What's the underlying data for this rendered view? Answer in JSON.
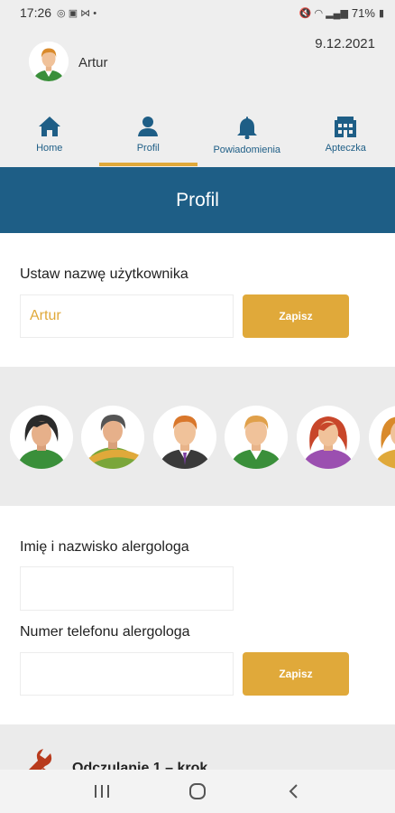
{
  "statusbar": {
    "time": "17:26",
    "battery": "71%"
  },
  "header": {
    "username": "Artur",
    "date": "9.12.2021"
  },
  "tabs": [
    {
      "label": "Home",
      "icon": "home-icon"
    },
    {
      "label": "Profil",
      "icon": "user-icon"
    },
    {
      "label": "Powiadomienia",
      "icon": "bell-icon"
    },
    {
      "label": "Apteczka",
      "icon": "pharmacy-icon"
    }
  ],
  "banner": {
    "title": "Profil"
  },
  "username_section": {
    "label": "Ustaw nazwę użytkownika",
    "value": "Artur",
    "save_label": "Zapisz"
  },
  "allergist": {
    "name_label": "Imię i nazwisko alergologa",
    "name_value": "",
    "phone_label": "Numer telefonu alergologa",
    "phone_value": "",
    "save_label": "Zapisz"
  },
  "next_section": {
    "title": "Odczulanie 1 – krok"
  },
  "colors": {
    "primary": "#1e5e86",
    "accent": "#e0a93a"
  }
}
